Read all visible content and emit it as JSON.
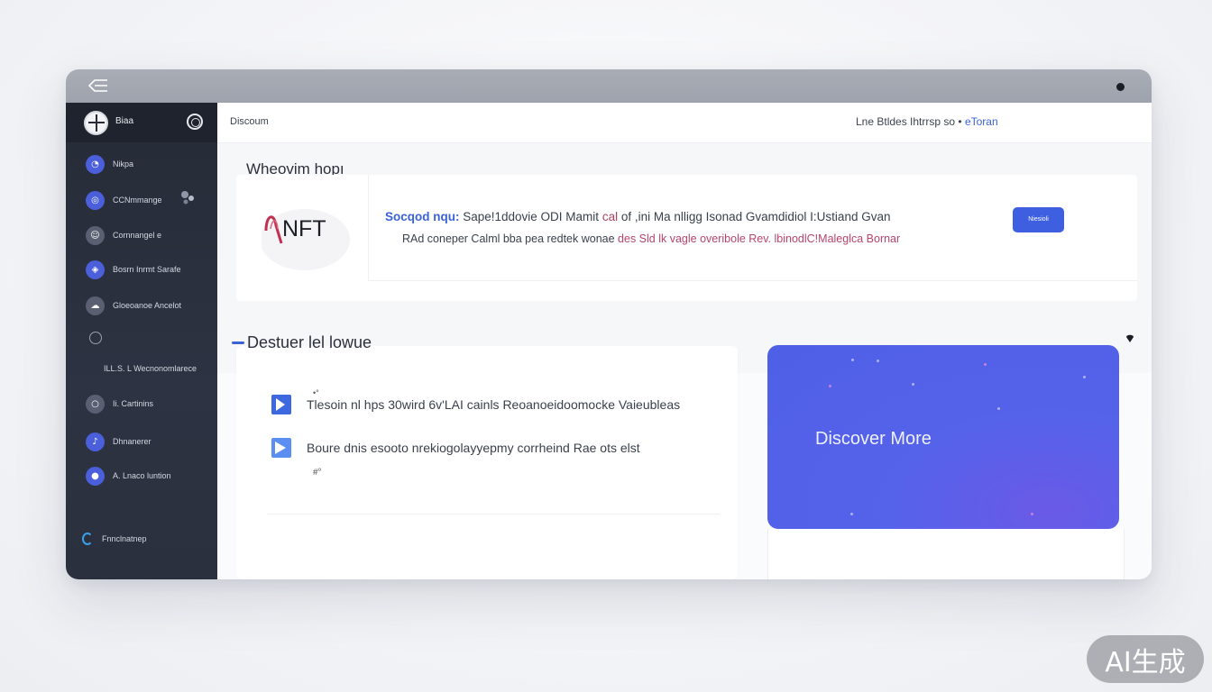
{
  "sidebar": {
    "brand": "Biaa",
    "items": [
      {
        "label": "Nikpa",
        "icon": "compass-icon"
      },
      {
        "label": "CCNmmange",
        "icon": "globe-icon"
      },
      {
        "label": "Cornnangel e",
        "icon": "user-icon"
      },
      {
        "label": "Bosrn Inrmt Sarafe",
        "icon": "shield-icon"
      },
      {
        "label": "Gloeoanoe Ancelot",
        "icon": "cloud-icon"
      },
      {
        "label": "",
        "icon": "link-icon"
      },
      {
        "label": "Ii. Cartinins",
        "icon": "circle-icon"
      },
      {
        "label": "Dhnanerer",
        "icon": "music-icon"
      },
      {
        "label": "A. Lnaco luntion",
        "icon": "person-icon"
      }
    ],
    "sub_label": "ILL.S. L Wecnonomlarece",
    "footer": "Fnnclnatnep"
  },
  "topbar": {
    "breadcrumb": "Discoum",
    "right_text": "Lne Btldes Ihtrrsp so •",
    "right_accent": "eToran"
  },
  "welcome": "Wheovim hopı",
  "feature": {
    "logo_text": "NFT",
    "line1_highlight": "Socqod nqu:",
    "line1_text": " Sape!1ddovie ODI Mamit ",
    "line1_pink": "cal",
    "line1_rest": " of ,ini Ma nlligg Isonad Gvamdidiol I:Ustiand Gvan",
    "line2_text": "RAd coneper Calml bba pea redtek wonae ",
    "line2_pink": "des Sld lk vagle overibole Rev. lbinodlC!Maleglca Bornar",
    "button_label": "Niesioli"
  },
  "section": {
    "title": "Destuer lel lowue"
  },
  "list": {
    "rows": [
      {
        "text": "Tlesoin nl hps 30wird 6v'LAI cainls Reoanoeidoomocke Vaieubleas",
        "icon": "document-icon"
      },
      {
        "text": "Boure dnis esooto nrekiogolayyepmy corrheind Rae ots elst",
        "icon": "document-icon"
      }
    ]
  },
  "promo": {
    "label": "Discover More"
  },
  "badge": "AI生成"
}
